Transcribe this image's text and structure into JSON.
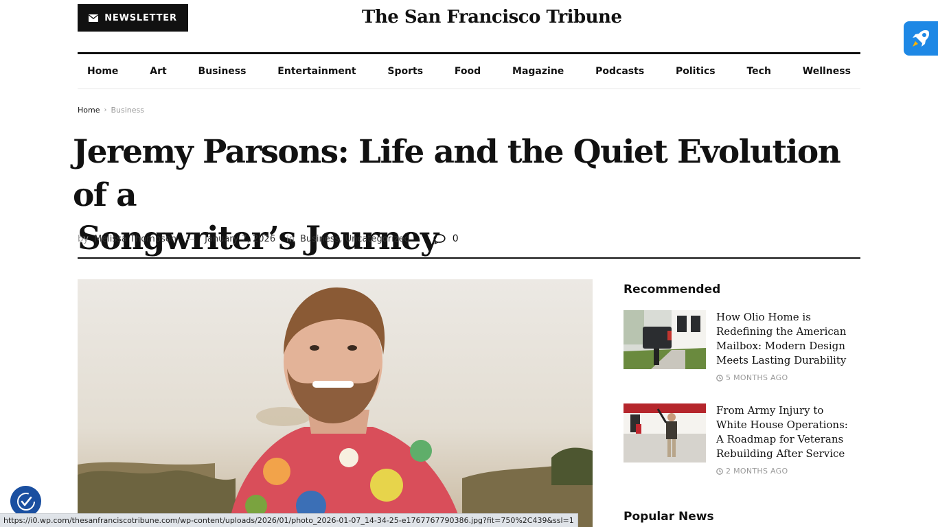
{
  "header": {
    "newsletter_label": "NEWSLETTER",
    "logo_text": "The San Francisco Tribune"
  },
  "nav": {
    "items": [
      "Home",
      "Art",
      "Business",
      "Entertainment",
      "Sports",
      "Food",
      "Magazine",
      "Podcasts",
      "Politics",
      "Tech",
      "Wellness"
    ]
  },
  "breadcrumb": {
    "home": "Home",
    "current": "Business"
  },
  "article": {
    "title_line1": "Jeremy Parsons: Life and the Quiet Evolution of a",
    "title_line2": "Songwriter’s Journey",
    "by_label": "by",
    "author": "Melissa Thompson",
    "date": "January 7, 2026",
    "in_label": "in",
    "category1": "Business",
    "category2": "Uncategorized",
    "comment_count": "0"
  },
  "sidebar": {
    "recommended_heading": "Recommended",
    "items": [
      {
        "title": "How Olio Home is Redefining the American Mailbox: Modern Design Meets Lasting Durability",
        "date": "5 MONTHS AGO"
      },
      {
        "title": "From Army Injury to White House Operations: A Roadmap for Veterans Rebuilding After Service",
        "date": "2 MONTHS AGO"
      }
    ],
    "popular_heading": "Popular News"
  },
  "status_bar": {
    "url": "https://i0.wp.com/thesanfranciscotribune.com/wp-content/uploads/2026/01/photo_2026-01-07_14-34-25-e1767767790386.jpg?fit=750%2C439&ssl=1"
  },
  "colors": {
    "brand_dark": "#111111",
    "accent_blue": "#1e88e5",
    "muted_text": "#999999"
  },
  "icons": [
    "envelope-icon",
    "rocket-icon",
    "comment-icon",
    "clock-icon",
    "accessibility-icon",
    "chevron-right-icon"
  ]
}
